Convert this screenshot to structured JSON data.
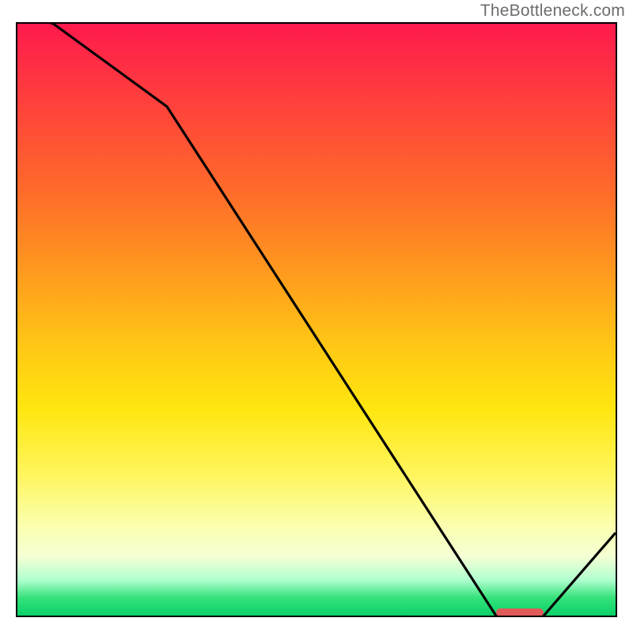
{
  "watermark": "TheBottleneck.com",
  "chart_data": {
    "type": "line",
    "title": "",
    "xlabel": "",
    "ylabel": "",
    "xlim": [
      0,
      100
    ],
    "ylim": [
      0,
      100
    ],
    "x": [
      0,
      6,
      25,
      80,
      88,
      100
    ],
    "values": [
      102,
      100,
      86,
      0,
      0,
      14
    ],
    "note": "V-shaped black curve over vertical red→green gradient; optimum region marked near x≈80–88 at y≈0.",
    "optimum_band": {
      "x_start": 80,
      "x_end": 88,
      "y": 0
    }
  },
  "colors": {
    "curve": "#000000",
    "marker": "#e05a5a"
  }
}
